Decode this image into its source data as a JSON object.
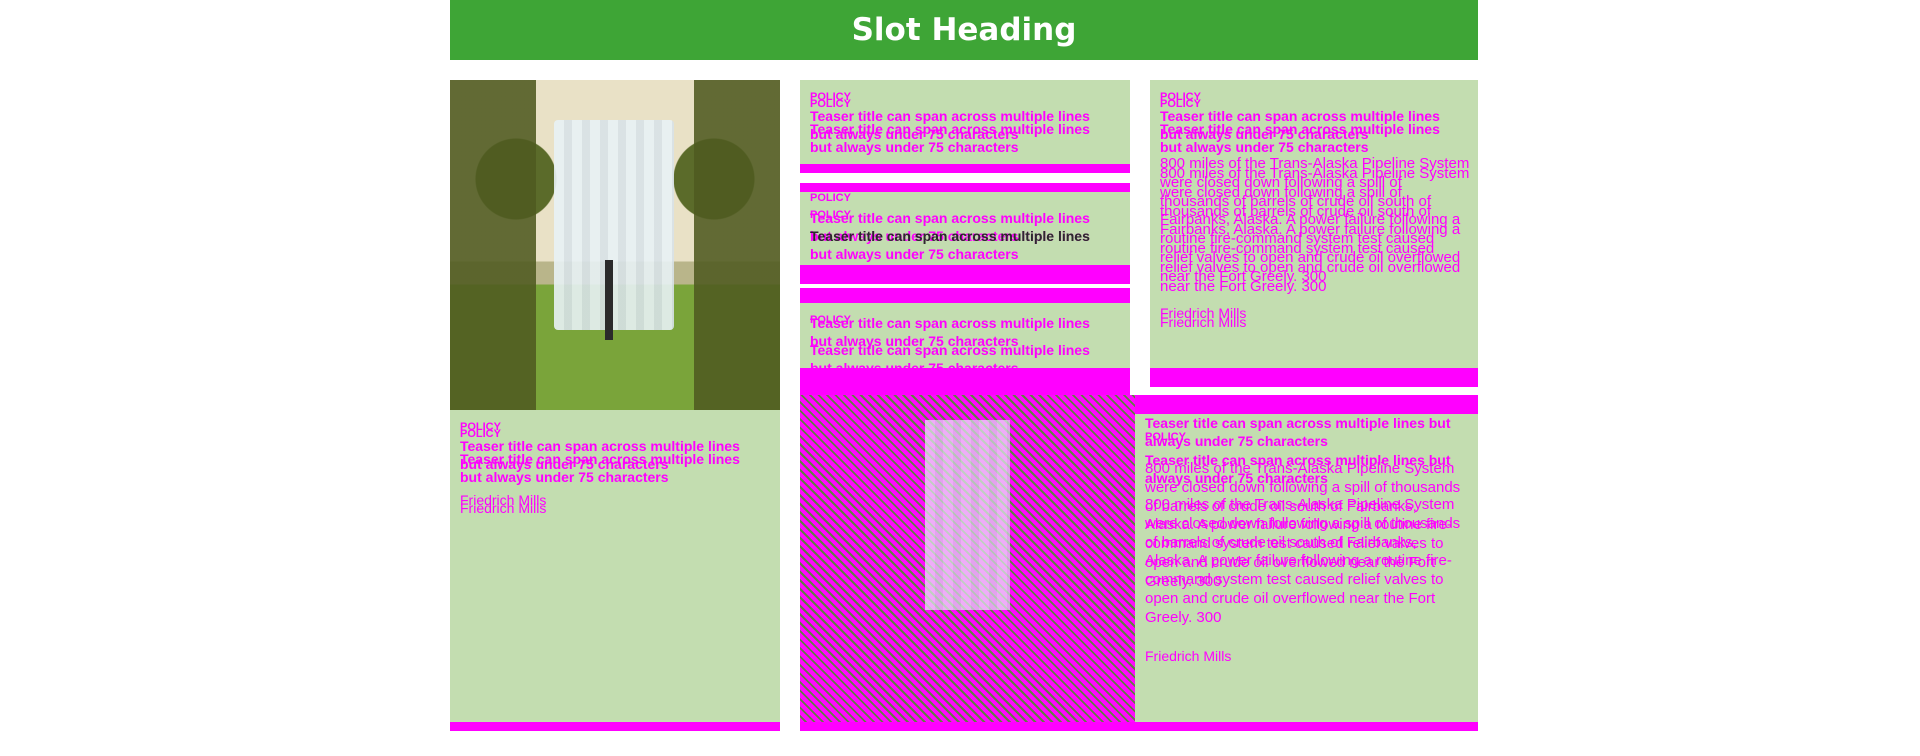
{
  "header": {
    "title": "Slot Heading"
  },
  "colors": {
    "header": "#3ea536",
    "card_bg": "#c3ddb0",
    "magenta": "#ff00ff"
  },
  "card1": {
    "label": "POLICY",
    "title": "Teaser title can span across multiple lines but always under 75 characters",
    "author": "Friedrich Mills"
  },
  "card2": {
    "label": "POLICY",
    "title": "Teaser title can span across multiple lines but always under 75 characters"
  },
  "card3": {
    "label": "POLICY",
    "title": "Teaser title can span across multiple lines but always under 75 characters",
    "excerpt": "800 miles of the Trans-Alaska Pipeline System were closed down following a spill of thousands of barrels of crude oil south of Fairbanks, Alaska. A power failure following a routine fire-command system test caused relief valves to open and crude oil overflowed near the Fort Greely. 300",
    "author": "Friedrich Mills"
  },
  "card4": {
    "label": "POLICY",
    "title": "Teaser title can span across multiple lines but always under 75 characters"
  },
  "card5": {
    "label": "POLICY",
    "title": "Teaser title can span across multiple lines but always under 75 characters"
  },
  "card6": {
    "label": "POLICY",
    "title": "Teaser title can span across multiple lines but always under 75 characters",
    "excerpt": "800 miles of the Trans-Alaska Pipeline System were closed down following a spill of thousands of barrels of crude oil south of Fairbanks, Alaska. A power failure following a routine fire-command system test caused relief valves to open and crude oil overflowed near the Fort Greely. 300",
    "author": "Friedrich Mills"
  },
  "overlay": {
    "text": "Teaser title can span across multiple lines"
  }
}
